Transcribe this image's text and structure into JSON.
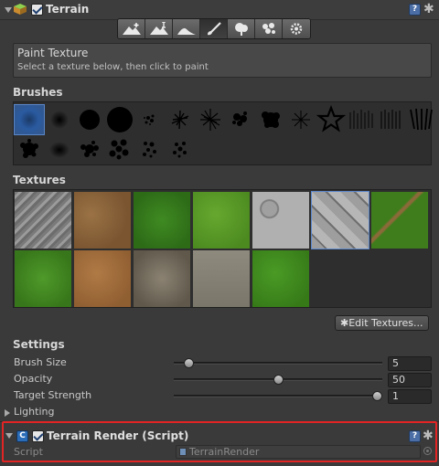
{
  "terrain": {
    "title": "Terrain",
    "tools": [
      "raise-lower-icon",
      "paint-height-icon",
      "smooth-height-icon",
      "paint-texture-icon",
      "place-trees-icon",
      "paint-details-icon",
      "settings-icon"
    ],
    "active_tool": "paint-texture-icon",
    "info_title": "Paint Texture",
    "info_subtitle": "Select a texture below, then click to paint",
    "brushes_label": "Brushes",
    "textures_label": "Textures",
    "edit_textures_label": "✱Edit Textures...",
    "settings_label": "Settings",
    "brush_size_label": "Brush Size",
    "brush_size_value": "5",
    "brush_size_fraction": 0.05,
    "opacity_label": "Opacity",
    "opacity_value": "50",
    "opacity_fraction": 0.5,
    "target_strength_label": "Target Strength",
    "target_strength_value": "1",
    "target_strength_fraction": 1.0,
    "lighting_label": "Lighting"
  },
  "terrain_render": {
    "title": "Terrain Render (Script)",
    "script_label": "Script",
    "script_value": "TerrainRender"
  },
  "colors": {
    "background": "#3a3a3a",
    "accent": "#5a86c8",
    "highlight": "#e32424"
  }
}
